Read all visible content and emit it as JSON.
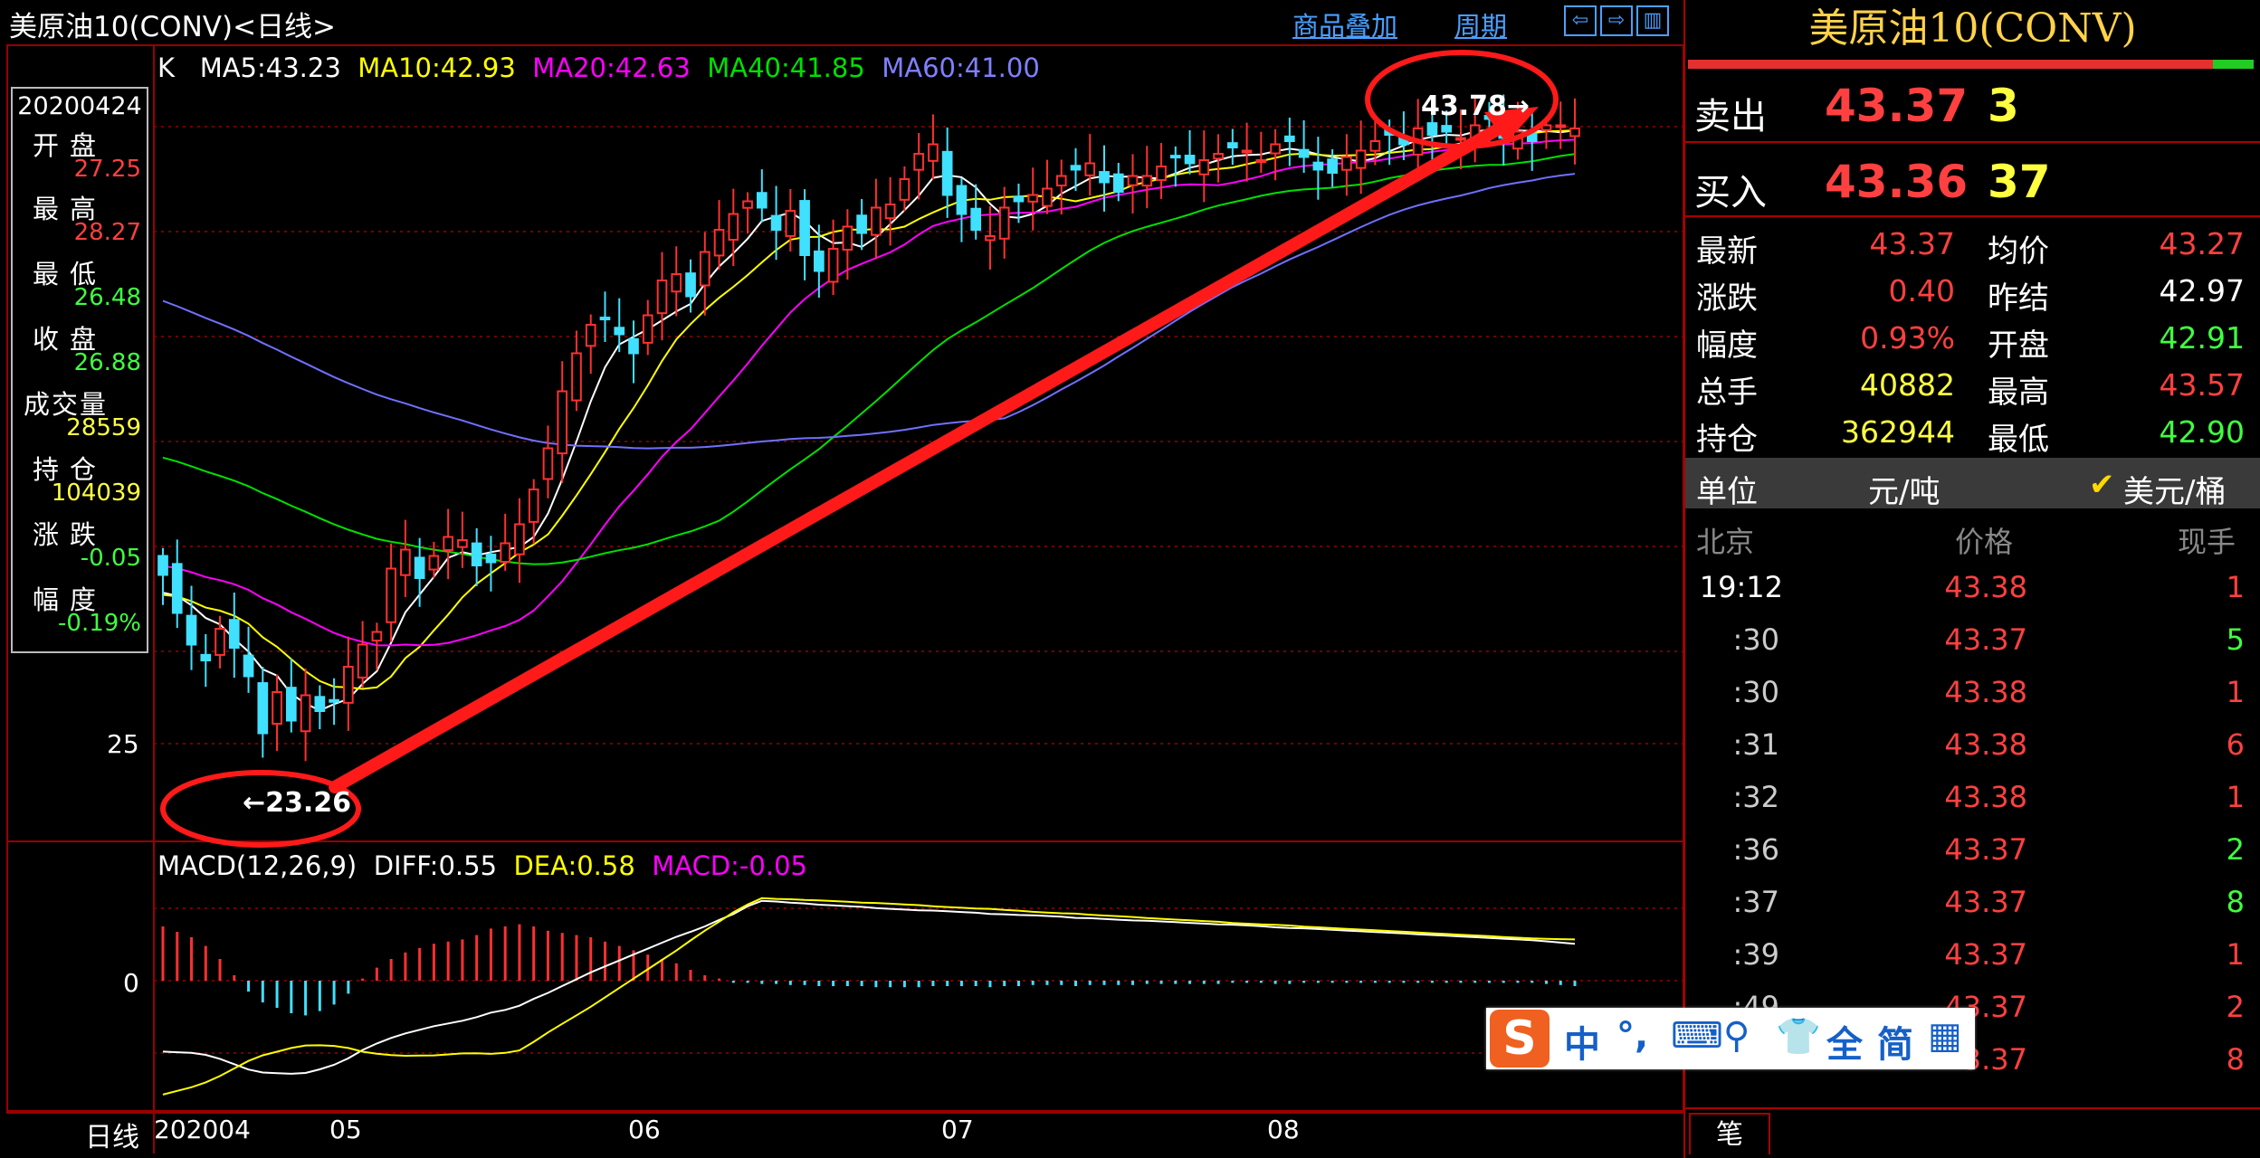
{
  "window": {
    "title": "美原油10(CONV)<日线>",
    "overlay_label": "商品叠加",
    "period_label": "周期"
  },
  "colors": {
    "up": "#ff3030",
    "down": "#40e0ff",
    "ma5": "#ffffff",
    "ma10": "#ffff00",
    "ma20": "#ff00ff",
    "ma40": "#00e000",
    "ma60": "#7070ff",
    "grid": "#990000",
    "annotation": "#ff1a1a",
    "accent": "#4aa0ff"
  },
  "icons": [
    "arrow-left-icon",
    "arrow-right-icon",
    "panel-layout-icon",
    "checkmark-icon"
  ],
  "main_legend": {
    "k": "K",
    "ma5": "MA5:43.23",
    "ma10": "MA10:42.93",
    "ma20": "MA20:42.63",
    "ma40": "MA40:41.85",
    "ma60": "MA60:41.00"
  },
  "info_box": {
    "date": "20200424",
    "rows": [
      {
        "label": "开盘",
        "value": "27.25",
        "color": "#ff4040"
      },
      {
        "label": "最高",
        "value": "28.27",
        "color": "#ff4040"
      },
      {
        "label": "最低",
        "value": "26.48",
        "color": "#40ff40"
      },
      {
        "label": "收盘",
        "value": "26.88",
        "color": "#40ff40"
      },
      {
        "label": "成交量",
        "value": "28559",
        "color": "#ffff40"
      },
      {
        "label": "持仓",
        "value": "104039",
        "color": "#ffff40"
      },
      {
        "label": "涨跌",
        "value": "-0.05",
        "color": "#40ff40"
      },
      {
        "label": "幅度",
        "value": "-0.19%",
        "color": "#40ff40"
      }
    ]
  },
  "price_axis_label": "25",
  "macd": {
    "legend_title": "MACD(12,26,9)",
    "diff": "DIFF:0.55",
    "dea": "DEA:0.58",
    "macd": "MACD:-0.05",
    "zero_label": "0"
  },
  "time_axis": {
    "label": "日线",
    "ticks": [
      "202004",
      "05",
      "06",
      "07",
      "08"
    ]
  },
  "annotations": {
    "low": "←23.26",
    "high": "43.78→"
  },
  "chart_data": {
    "type": "candlestick",
    "period": "daily",
    "x_ticks": [
      "202004",
      "05",
      "06",
      "07",
      "08"
    ],
    "y_tick": 25,
    "marked_low": 23.26,
    "marked_high": 43.78,
    "latest_ma": {
      "MA5": 43.23,
      "MA10": 42.93,
      "MA20": 42.63,
      "MA40": 41.85,
      "MA60": 41.0
    },
    "close_series": [
      29.2,
      28.0,
      27.0,
      26.5,
      27.5,
      26.9,
      26.0,
      24.2,
      25.5,
      24.6,
      25.4,
      24.9,
      25.2,
      26.3,
      27.0,
      27.4,
      29.4,
      30.0,
      29.1,
      29.8,
      30.4,
      30.3,
      29.5,
      29.6,
      30.2,
      30.8,
      31.9,
      33.2,
      35.0,
      36.2,
      37.1,
      37.3,
      36.8,
      36.2,
      37.4,
      38.5,
      38.7,
      38.0,
      39.4,
      40.1,
      40.6,
      41.0,
      40.8,
      40.1,
      40.7,
      39.3,
      38.8,
      39.5,
      40.2,
      40.0,
      40.8,
      40.9,
      41.7,
      42.5,
      42.8,
      41.2,
      40.6,
      40.1,
      39.9,
      40.8,
      41.0,
      41.2,
      41.4,
      41.8,
      42.0,
      42.2,
      41.6,
      41.3,
      41.8,
      41.8,
      42.1,
      42.4,
      42.2,
      42.3,
      42.5,
      42.7,
      42.6,
      42.3,
      42.8,
      42.9,
      42.4,
      42.0,
      41.9,
      42.4,
      42.6,
      42.9,
      43.1,
      42.8,
      43.3,
      43.1,
      43.2,
      43.0,
      43.4,
      43.6,
      43.0,
      43.2,
      42.9,
      43.4,
      43.4,
      43.3
    ],
    "macd_hist": [
      0.5,
      0.45,
      0.4,
      0.32,
      0.2,
      0.05,
      -0.1,
      -0.2,
      -0.25,
      -0.3,
      -0.32,
      -0.28,
      -0.22,
      -0.12,
      0.02,
      0.12,
      0.2,
      0.26,
      0.3,
      0.34,
      0.36,
      0.38,
      0.42,
      0.48,
      0.5,
      0.52,
      0.5,
      0.46,
      0.44,
      0.42,
      0.4,
      0.36,
      0.32,
      0.28,
      0.24,
      0.2,
      0.16,
      0.1,
      0.05,
      0.02,
      -0.02,
      -0.02,
      -0.03,
      -0.03,
      -0.04,
      -0.04,
      -0.05,
      -0.05,
      -0.05,
      -0.05,
      -0.06,
      -0.06,
      -0.06,
      -0.06,
      -0.05,
      -0.05,
      -0.05,
      -0.05,
      -0.06,
      -0.05,
      -0.05,
      -0.04,
      -0.04,
      -0.04,
      -0.05,
      -0.04,
      -0.04,
      -0.04,
      -0.04,
      -0.03,
      -0.03,
      -0.03,
      -0.03,
      -0.03,
      -0.03,
      -0.02,
      -0.02,
      -0.02,
      -0.03,
      -0.03,
      -0.02,
      -0.02,
      -0.02,
      -0.02,
      -0.02,
      -0.02,
      -0.02,
      -0.02,
      -0.02,
      -0.02,
      -0.02,
      -0.02,
      -0.02,
      -0.02,
      -0.02,
      -0.02,
      -0.02,
      -0.03,
      -0.04,
      -0.05
    ]
  },
  "quote": {
    "symbol": "美原油10(CONV)",
    "sell_label": "卖出",
    "sell_price": "43.37",
    "sell_qty": "3",
    "buy_label": "买入",
    "buy_price": "43.36",
    "buy_qty": "37",
    "rows": [
      {
        "l1": "最新",
        "v1": "43.37",
        "c1": "#ff4040",
        "l2": "均价",
        "v2": "43.27",
        "c2": "#ff4040"
      },
      {
        "l1": "涨跌",
        "v1": "0.40",
        "c1": "#ff4040",
        "l2": "昨结",
        "v2": "42.97",
        "c2": "#ffffff"
      },
      {
        "l1": "幅度",
        "v1": "0.93%",
        "c1": "#ff4040",
        "l2": "开盘",
        "v2": "42.91",
        "c2": "#40ff40"
      },
      {
        "l1": "总手",
        "v1": "40882",
        "c1": "#ffff40",
        "l2": "最高",
        "v2": "43.57",
        "c2": "#ff4040"
      },
      {
        "l1": "持仓",
        "v1": "362944",
        "c1": "#ffff40",
        "l2": "最低",
        "v2": "42.90",
        "c2": "#40ff40"
      }
    ],
    "unit_label": "单位",
    "unit_option_1": "元/吨",
    "unit_option_2": "美元/桶"
  },
  "ticks": {
    "header_time": "北京",
    "header_price": "价格",
    "header_qty": "现手",
    "rows": [
      {
        "time": "19:12",
        "price": "43.38",
        "qty": "1",
        "qcolor": "#ff4040"
      },
      {
        "time": ":30",
        "price": "43.37",
        "qty": "5",
        "qcolor": "#40ff40"
      },
      {
        "time": ":30",
        "price": "43.38",
        "qty": "1",
        "qcolor": "#ff4040"
      },
      {
        "time": ":31",
        "price": "43.38",
        "qty": "6",
        "qcolor": "#ff4040"
      },
      {
        "time": ":32",
        "price": "43.38",
        "qty": "1",
        "qcolor": "#ff4040"
      },
      {
        "time": ":36",
        "price": "43.37",
        "qty": "2",
        "qcolor": "#40ff40"
      },
      {
        "time": ":37",
        "price": "43.37",
        "qty": "8",
        "qcolor": "#40ff40"
      },
      {
        "time": ":39",
        "price": "43.37",
        "qty": "1",
        "qcolor": "#ff4040"
      },
      {
        "time": ":49",
        "price": "43.37",
        "qty": "2",
        "qcolor": "#ff4040"
      },
      {
        "time": "",
        "price": "43.37",
        "qty": "8",
        "qcolor": "#ff4040"
      }
    ],
    "tab_label": "笔"
  },
  "ime": {
    "logo": "S",
    "items": [
      "中",
      "°,",
      "⌨",
      "⚲",
      "👕",
      "全",
      "简",
      "▦"
    ]
  }
}
